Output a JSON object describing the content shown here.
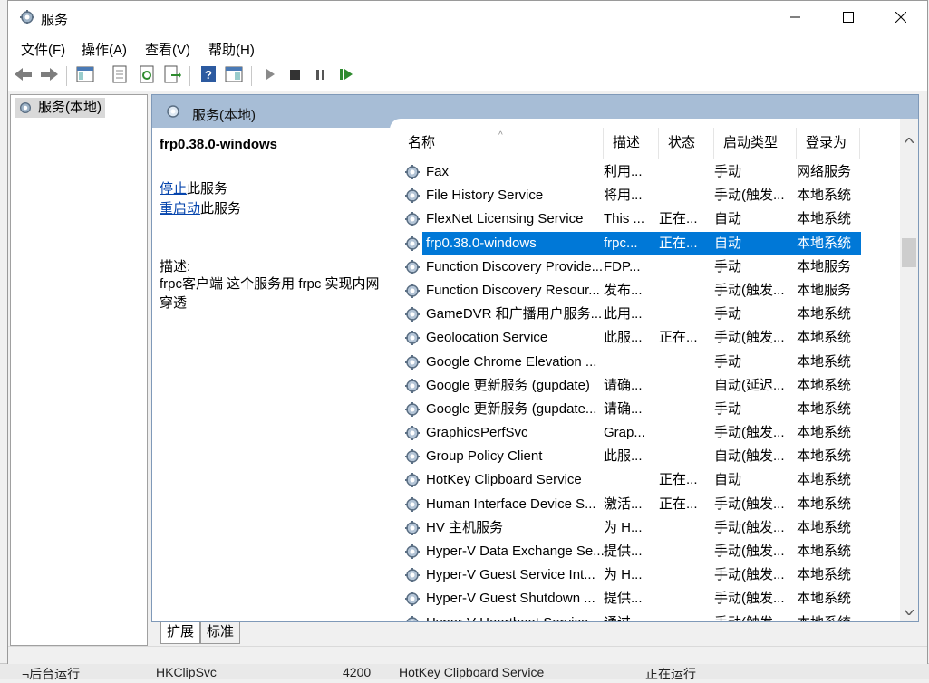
{
  "window": {
    "title": "服务"
  },
  "menu": [
    "文件(F)",
    "操作(A)",
    "查看(V)",
    "帮助(H)"
  ],
  "tree": {
    "root": "服务(本地)"
  },
  "panel": {
    "header": "服务(本地)"
  },
  "detail": {
    "service_name": "frp0.38.0-windows",
    "stop_link": "停止",
    "stop_suffix": "此服务",
    "restart_link": "重启动",
    "restart_suffix": "此服务",
    "desc_label": "描述:",
    "desc_text": "frpc客户端 这个服务用 frpc 实现内网穿透"
  },
  "columns": [
    "名称",
    "描述",
    "状态",
    "启动类型",
    "登录为"
  ],
  "services": [
    {
      "name": "Fax",
      "desc": "利用...",
      "status": "",
      "startup": "手动",
      "logon": "网络服务"
    },
    {
      "name": "File History Service",
      "desc": "将用...",
      "status": "",
      "startup": "手动(触发...",
      "logon": "本地系统"
    },
    {
      "name": "FlexNet Licensing Service",
      "desc": "This ...",
      "status": "正在...",
      "startup": "自动",
      "logon": "本地系统"
    },
    {
      "name": "frp0.38.0-windows",
      "desc": "frpc...",
      "status": "正在...",
      "startup": "自动",
      "logon": "本地系统",
      "selected": true
    },
    {
      "name": "Function Discovery Provide...",
      "desc": "FDP...",
      "status": "",
      "startup": "手动",
      "logon": "本地服务"
    },
    {
      "name": "Function Discovery Resour...",
      "desc": "发布...",
      "status": "",
      "startup": "手动(触发...",
      "logon": "本地服务"
    },
    {
      "name": "GameDVR 和广播用户服务...",
      "desc": "此用...",
      "status": "",
      "startup": "手动",
      "logon": "本地系统"
    },
    {
      "name": "Geolocation Service",
      "desc": "此服...",
      "status": "正在...",
      "startup": "手动(触发...",
      "logon": "本地系统"
    },
    {
      "name": "Google Chrome Elevation ...",
      "desc": "",
      "status": "",
      "startup": "手动",
      "logon": "本地系统"
    },
    {
      "name": "Google 更新服务 (gupdate)",
      "desc": "请确...",
      "status": "",
      "startup": "自动(延迟...",
      "logon": "本地系统"
    },
    {
      "name": "Google 更新服务 (gupdate...",
      "desc": "请确...",
      "status": "",
      "startup": "手动",
      "logon": "本地系统"
    },
    {
      "name": "GraphicsPerfSvc",
      "desc": "Grap...",
      "status": "",
      "startup": "手动(触发...",
      "logon": "本地系统"
    },
    {
      "name": "Group Policy Client",
      "desc": "此服...",
      "status": "",
      "startup": "自动(触发...",
      "logon": "本地系统"
    },
    {
      "name": "HotKey Clipboard Service",
      "desc": "",
      "status": "正在...",
      "startup": "自动",
      "logon": "本地系统"
    },
    {
      "name": "Human Interface Device S...",
      "desc": "激活...",
      "status": "正在...",
      "startup": "手动(触发...",
      "logon": "本地系统"
    },
    {
      "name": "HV 主机服务",
      "desc": "为 H...",
      "status": "",
      "startup": "手动(触发...",
      "logon": "本地系统"
    },
    {
      "name": "Hyper-V Data Exchange Se...",
      "desc": "提供...",
      "status": "",
      "startup": "手动(触发...",
      "logon": "本地系统"
    },
    {
      "name": "Hyper-V Guest Service Int...",
      "desc": "为 H...",
      "status": "",
      "startup": "手动(触发...",
      "logon": "本地系统"
    },
    {
      "name": "Hyper-V Guest Shutdown ...",
      "desc": "提供...",
      "status": "",
      "startup": "手动(触发...",
      "logon": "本地系统"
    },
    {
      "name": "Hyper-V Heartbeat Service",
      "desc": "通过...",
      "status": "",
      "startup": "手动(触发...",
      "logon": "本地系统"
    }
  ],
  "tabs": [
    "扩展",
    "标准"
  ],
  "background": {
    "text_left": "¬后台运行",
    "text_mid": "HKClipSvc",
    "text_pid": "4200",
    "text_svc": "HotKey Clipboard Service",
    "text_status": "正在运行"
  },
  "colors": {
    "selection": "#0078d7",
    "header_band": "#a7bdd6",
    "link": "#0645ad"
  }
}
